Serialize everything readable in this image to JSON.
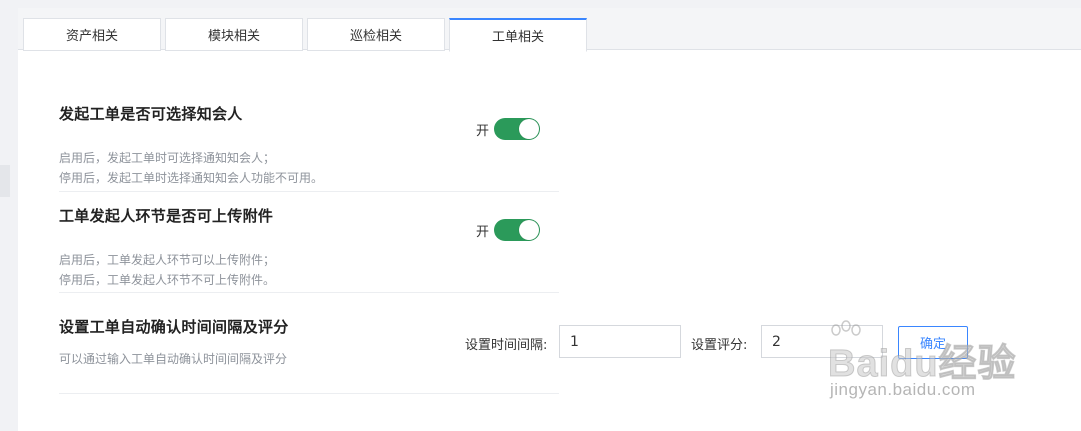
{
  "tabs": [
    {
      "label": "资产相关",
      "active": false
    },
    {
      "label": "模块相关",
      "active": false
    },
    {
      "label": "巡检相关",
      "active": false
    },
    {
      "label": "工单相关",
      "active": true
    }
  ],
  "settings": {
    "notify": {
      "title": "发起工单是否可选择知会人",
      "desc_on": "启用后，发起工单时可选择通知知会人；",
      "desc_off": "停用后，发起工单时选择通知知会人功能不可用。",
      "toggle_label": "开",
      "enabled": true
    },
    "attachment": {
      "title": "工单发起人环节是否可上传附件",
      "desc_on": "启用后，工单发起人环节可以上传附件；",
      "desc_off": "停用后，工单发起人环节不可上传附件。",
      "toggle_label": "开",
      "enabled": true
    },
    "auto_confirm": {
      "title": "设置工单自动确认时间间隔及评分",
      "desc": "可以通过输入工单自动确认时间间隔及评分",
      "interval_label": "设置时间间隔:",
      "interval_value": "1",
      "score_label": "设置评分:",
      "score_value": "2",
      "confirm_label": "确定"
    }
  },
  "watermark": {
    "brand": "Baidu经验",
    "url": "jingyan.baidu.com"
  },
  "colors": {
    "accent": "#3a86ff",
    "toggle_on": "#2b9a5a"
  }
}
